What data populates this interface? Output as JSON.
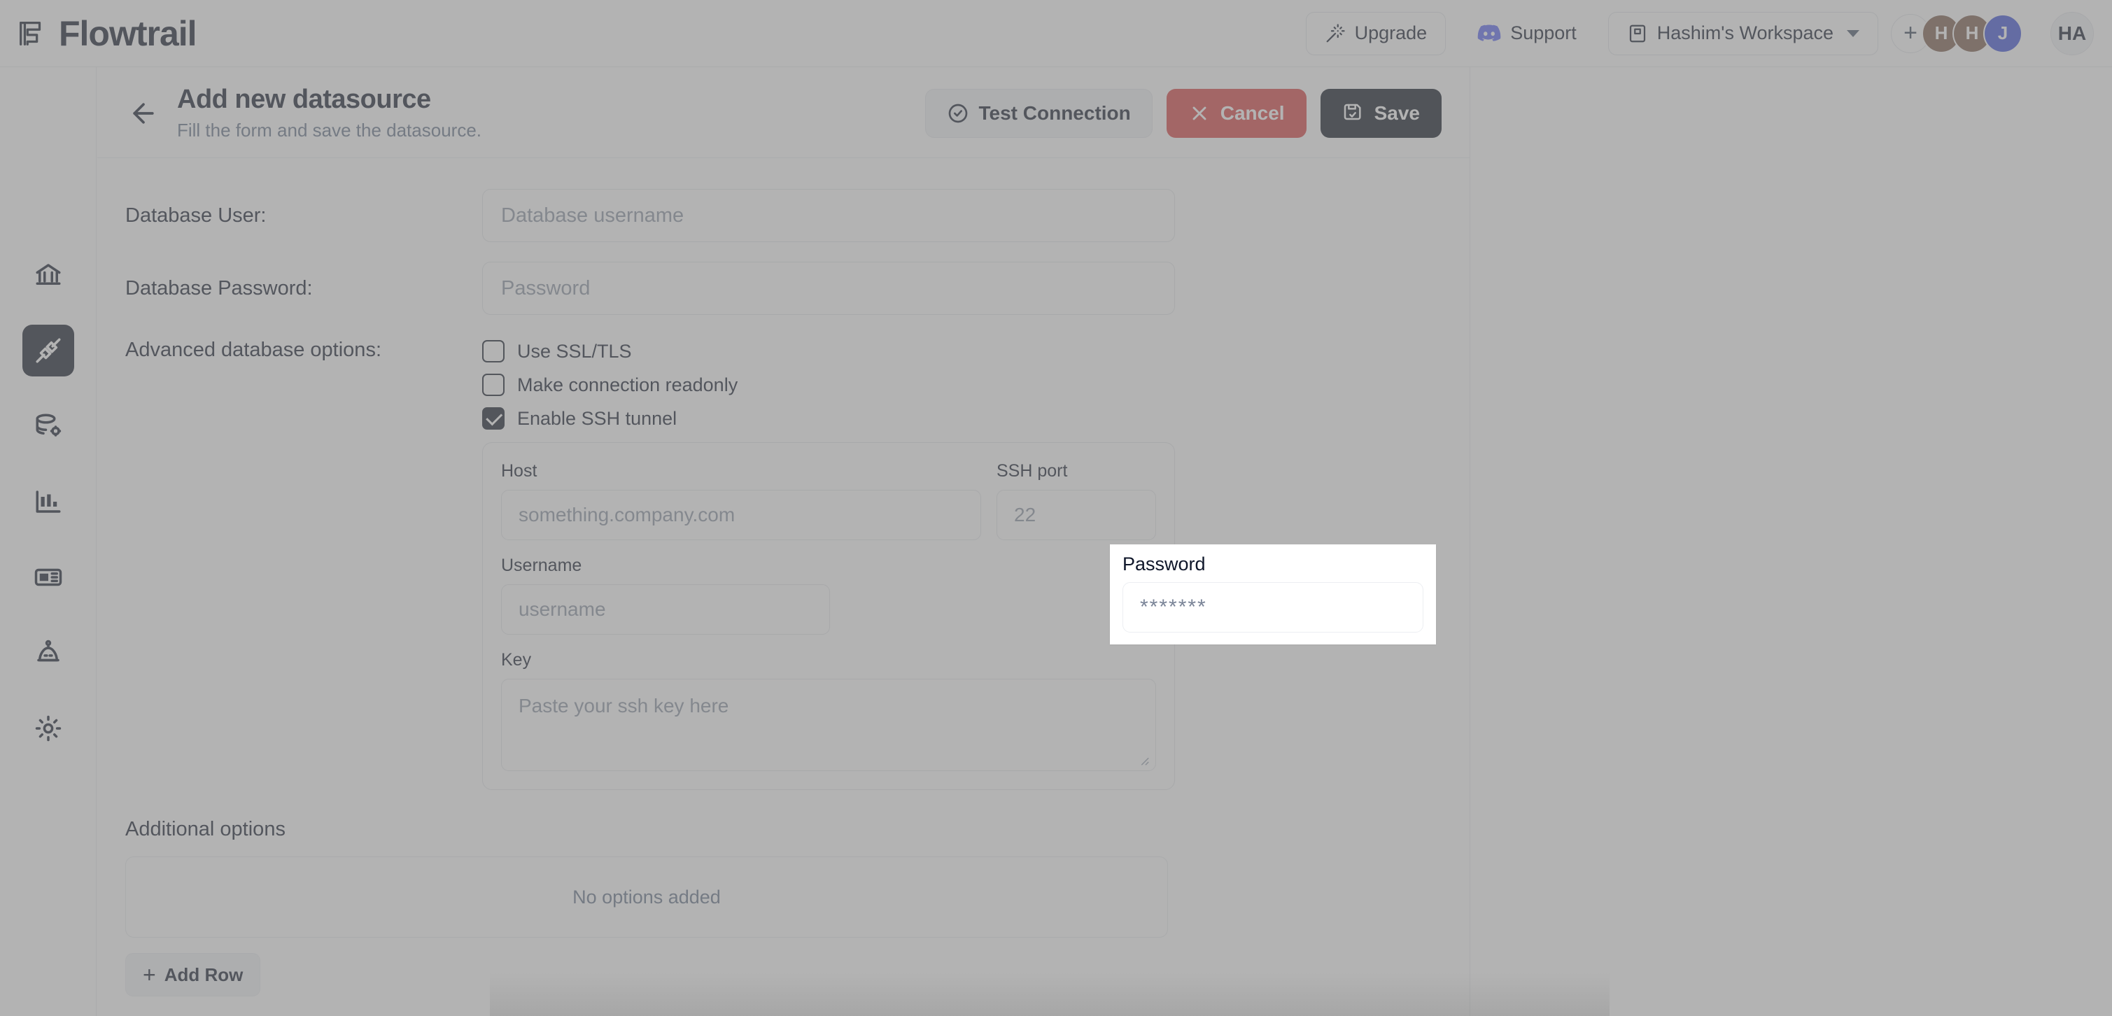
{
  "brand": {
    "name": "Flowtrail",
    "logo_icon": "flowtrail-logo-icon"
  },
  "topbar": {
    "upgrade": {
      "label": "Upgrade",
      "icon": "magic-wand-icon"
    },
    "support": {
      "label": "Support",
      "icon": "discord-icon",
      "icon_color": "#5865F2"
    },
    "workspace": {
      "label": "Hashim's Workspace",
      "icon": "workspace-icon",
      "chevron": "chevron-down-icon"
    },
    "avatars": [
      {
        "initials": "+",
        "color": "#ffffff",
        "name": "add-member-avatar"
      },
      {
        "initials": "H",
        "color": "#7a5b4a",
        "name": "member-avatar"
      },
      {
        "initials": "H",
        "color": "#7a5b4a",
        "name": "member-avatar"
      },
      {
        "initials": "J",
        "color": "#3b4fd8",
        "name": "member-avatar"
      }
    ],
    "account_avatar": "HA"
  },
  "sidebar": {
    "items": [
      {
        "icon": "bank-home-icon",
        "active": false
      },
      {
        "icon": "plug-connection-icon",
        "active": true
      },
      {
        "icon": "database-settings-icon",
        "active": false
      },
      {
        "icon": "bar-chart-icon",
        "active": false
      },
      {
        "icon": "dashboard-card-icon",
        "active": false
      },
      {
        "icon": "robot-ai-icon",
        "active": false
      },
      {
        "icon": "gear-settings-icon",
        "active": false
      }
    ]
  },
  "page": {
    "back_icon": "arrow-left-icon",
    "title": "Add new datasource",
    "subtitle": "Fill the form and save the datasource.",
    "actions": {
      "test_connection": {
        "label": "Test Connection",
        "icon": "check-circle-icon"
      },
      "cancel": {
        "label": "Cancel",
        "icon": "close-x-icon",
        "color": "#d7403f"
      },
      "save": {
        "label": "Save",
        "icon": "save-disk-icon",
        "color": "#0b1220"
      }
    }
  },
  "form": {
    "database_user": {
      "label": "Database User:",
      "value": "",
      "placeholder": "Database username"
    },
    "database_password": {
      "label": "Database Password:",
      "value": "",
      "placeholder": "Password"
    },
    "advanced_label": "Advanced database options:",
    "checkboxes": [
      {
        "label": "Use SSL/TLS",
        "checked": false
      },
      {
        "label": "Make connection readonly",
        "checked": false
      },
      {
        "label": "Enable SSH tunnel",
        "checked": true
      }
    ],
    "ssh": {
      "host": {
        "label": "Host",
        "value": "",
        "placeholder": "something.company.com"
      },
      "port": {
        "label": "SSH port",
        "value": "",
        "placeholder": "22"
      },
      "username": {
        "label": "Username",
        "value": "",
        "placeholder": "username"
      },
      "key": {
        "label": "Key",
        "value": "",
        "placeholder": "Paste your ssh key here"
      }
    },
    "additional_options": {
      "title": "Additional options",
      "empty_text": "No options added",
      "add_row_label": "Add Row",
      "add_row_icon": "plus-icon"
    }
  },
  "password_popup": {
    "label": "Password",
    "value": "*******",
    "placeholder": "Password"
  }
}
